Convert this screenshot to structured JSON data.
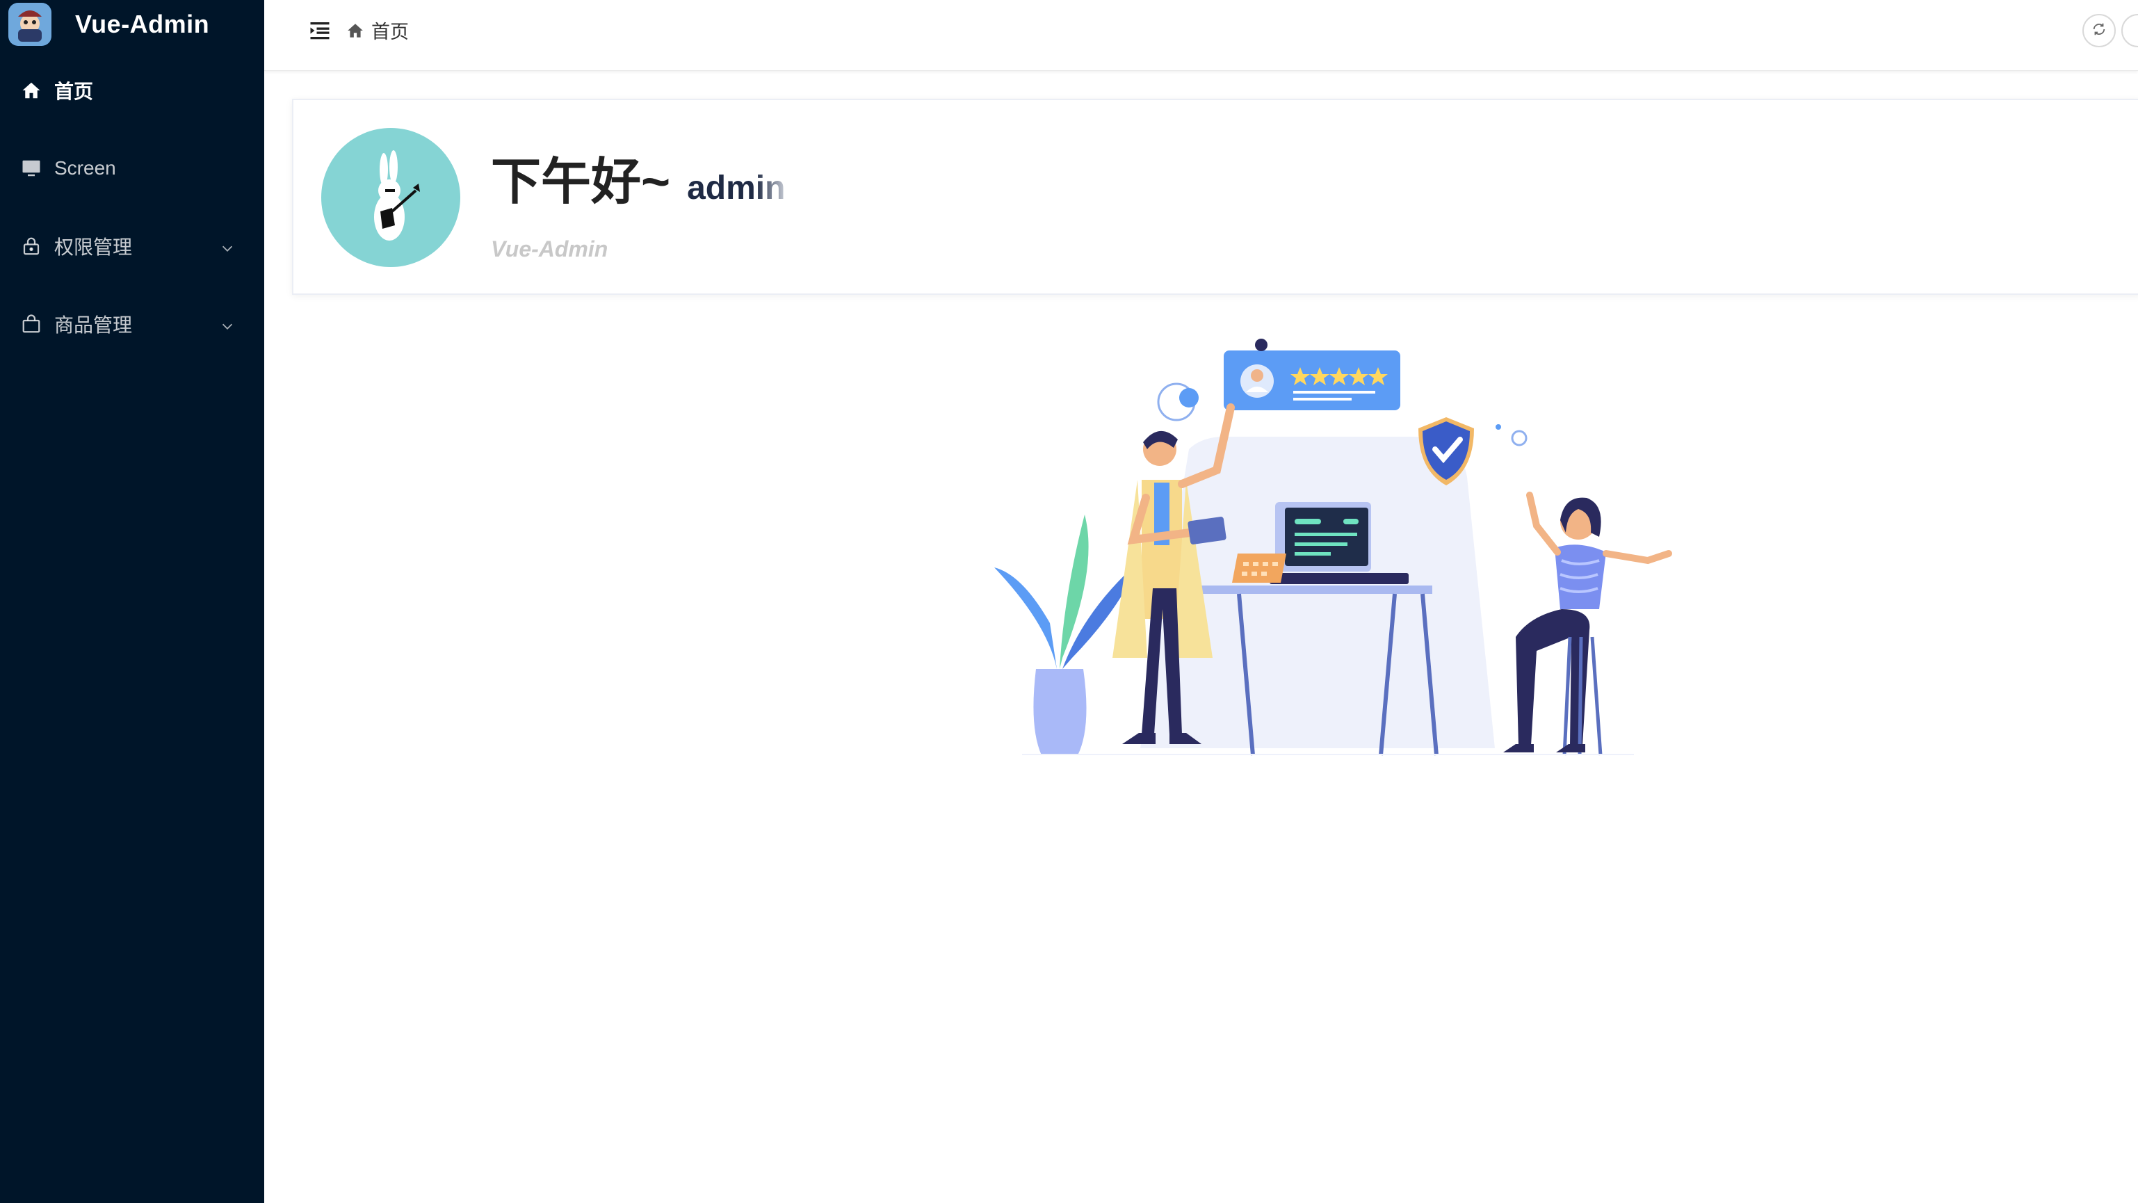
{
  "app": {
    "title": "Vue-Admin"
  },
  "sidebar": {
    "items": [
      {
        "label": "首页",
        "icon": "home-icon",
        "active": true,
        "has_children": false
      },
      {
        "label": "Screen",
        "icon": "monitor-icon",
        "active": false,
        "has_children": false
      },
      {
        "label": "权限管理",
        "icon": "lock-icon",
        "active": false,
        "has_children": true
      },
      {
        "label": "商品管理",
        "icon": "shopping-bag-icon",
        "active": false,
        "has_children": true
      }
    ]
  },
  "header": {
    "breadcrumb": [
      {
        "label": "首页",
        "icon": "home-icon"
      }
    ],
    "actions": [
      "refresh-icon"
    ]
  },
  "welcome": {
    "greeting": "下午好~",
    "username": "admin",
    "subtitle": "Vue-Admin"
  },
  "colors": {
    "sidebar_bg": "#001529",
    "avatar_bg": "#85d4d4",
    "accent_blue": "#5c9cf5"
  }
}
